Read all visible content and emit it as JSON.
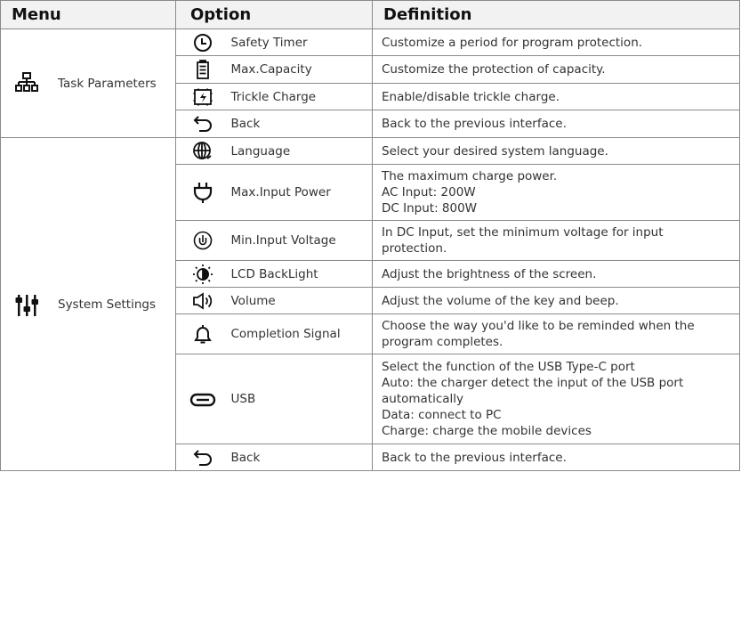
{
  "header": {
    "menu": "Menu",
    "option": "Option",
    "definition": "Definition"
  },
  "groups": [
    {
      "menu": "Task Parameters",
      "icon": "hierarchy-icon",
      "rows": [
        {
          "icon": "clock-icon",
          "option": "Safety Timer",
          "definition": [
            "Customize a period for program protection."
          ]
        },
        {
          "icon": "battery-icon",
          "option": "Max.Capacity",
          "definition": [
            "Customize the protection of capacity."
          ]
        },
        {
          "icon": "trickle-charge-icon",
          "option": "Trickle Charge",
          "definition": [
            "Enable/disable trickle charge."
          ]
        },
        {
          "icon": "back-arrow-icon",
          "option": "Back",
          "definition": [
            "Back to the previous interface."
          ]
        }
      ]
    },
    {
      "menu": "System Settings",
      "icon": "sliders-icon",
      "rows": [
        {
          "icon": "globe-icon",
          "option": "Language",
          "definition": [
            "Select your desired system language."
          ]
        },
        {
          "icon": "plug-icon",
          "option": "Max.Input Power",
          "definition": [
            "The maximum charge power.",
            "AC Input: 200W",
            "DC Input: 800W"
          ]
        },
        {
          "icon": "voltage-icon",
          "option": "Min.Input Voltage",
          "definition": [
            "In DC Input, set the minimum voltage for input",
            "protection."
          ]
        },
        {
          "icon": "backlight-icon",
          "option": "LCD BackLight",
          "definition": [
            "Adjust the brightness of the screen."
          ]
        },
        {
          "icon": "speaker-icon",
          "option": "Volume",
          "definition": [
            "Adjust the volume of the key and beep."
          ]
        },
        {
          "icon": "bell-icon",
          "option": "Completion Signal",
          "definition": [
            "Choose the way you'd like to be reminded when the",
            "program completes."
          ]
        },
        {
          "icon": "usb-c-icon",
          "option": "USB",
          "definition": [
            "Select the function of the USB Type-C port",
            "Auto: the charger detect the input of the USB port",
            "automatically",
            "Data: connect to PC",
            "Charge: charge the mobile devices"
          ]
        },
        {
          "icon": "back-arrow-icon",
          "option": "Back",
          "definition": [
            "Back to the previous interface."
          ]
        }
      ]
    }
  ]
}
